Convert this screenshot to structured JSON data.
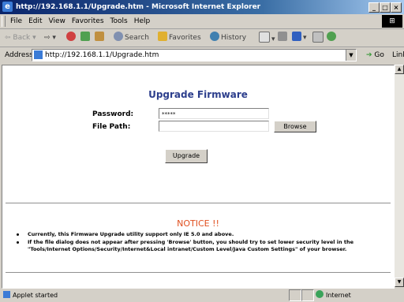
{
  "window": {
    "title": "http://192.168.1.1/Upgrade.htm - Microsoft Internet Explorer"
  },
  "menu": [
    "File",
    "Edit",
    "View",
    "Favorites",
    "Tools",
    "Help"
  ],
  "toolbar": {
    "back": "Back",
    "search": "Search",
    "favorites": "Favorites",
    "history": "History"
  },
  "address": {
    "label": "Address",
    "url": "http://192.168.1.1/Upgrade.htm",
    "go": "Go",
    "links": "Links"
  },
  "page": {
    "heading": "Upgrade Firmware",
    "password_label": "Password:",
    "password_value": "*****",
    "filepath_label": "File Path:",
    "filepath_value": "",
    "browse_button": "Browse",
    "upgrade_button": "Upgrade",
    "notice_title": "NOTICE !!",
    "notices": [
      "Currently, this Firmware Upgrade utility support only IE 5.0 and above.",
      "If the file dialog does not appear after pressing 'Browse' button, you should try to set lower security level in the \"Tools/Internet Options/Security/Internet&Local intranet/Custom Level/Java Custom Settings\" of your browser."
    ]
  },
  "status": {
    "text": "Applet started",
    "zone": "Internet"
  }
}
